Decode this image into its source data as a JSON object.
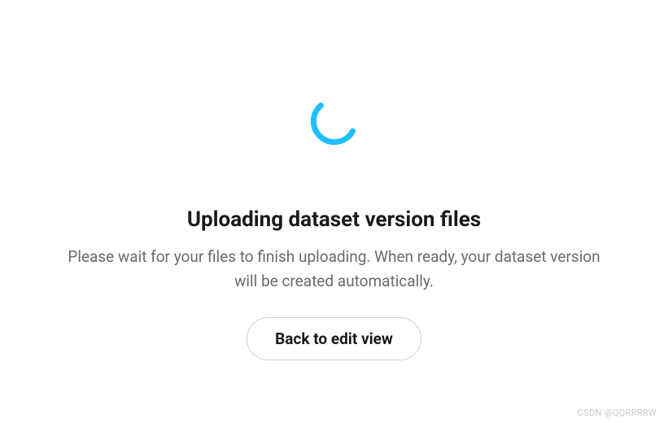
{
  "main": {
    "title": "Uploading dataset version files",
    "subtitle": "Please wait for your files to finish uploading. When ready, your dataset version will be created automatically.",
    "back_button_label": "Back to edit view"
  },
  "spinner": {
    "color": "#20beff"
  },
  "watermark": "CSDN @QQRRRRW"
}
